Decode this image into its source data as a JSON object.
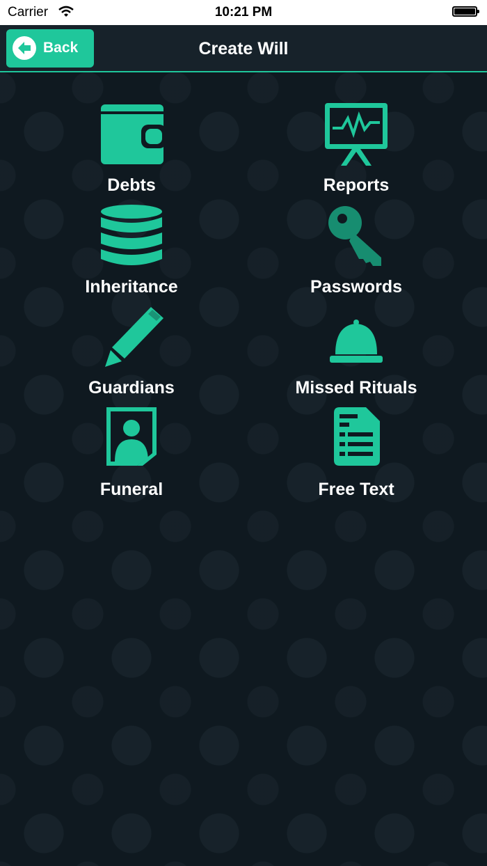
{
  "status_bar": {
    "carrier": "Carrier",
    "time": "10:21 PM"
  },
  "nav": {
    "back_label": "Back",
    "title": "Create Will"
  },
  "accent_color": "#1fc79b",
  "menu": [
    {
      "label": "Debts",
      "icon": "wallet-icon"
    },
    {
      "label": "Reports",
      "icon": "chart-board-icon"
    },
    {
      "label": "Inheritance",
      "icon": "database-icon"
    },
    {
      "label": "Passwords",
      "icon": "key-icon"
    },
    {
      "label": "Guardians",
      "icon": "pencil-icon"
    },
    {
      "label": "Missed Rituals",
      "icon": "bell-icon"
    },
    {
      "label": "Funeral",
      "icon": "portrait-icon"
    },
    {
      "label": "Free Text",
      "icon": "document-list-icon"
    }
  ]
}
